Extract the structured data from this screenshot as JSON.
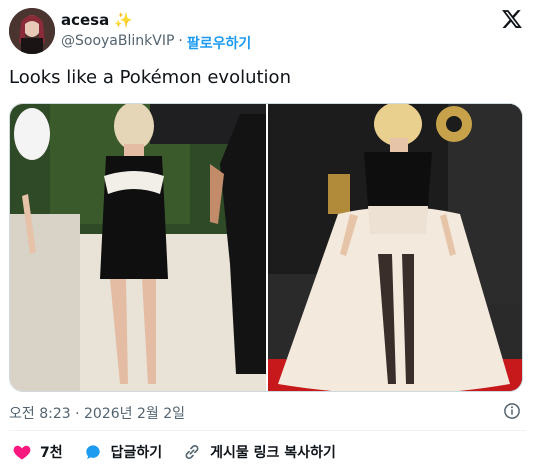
{
  "author": {
    "display_name": "acesa",
    "badge": "✨",
    "handle": "@SooyaBlinkVIP",
    "separator": "·",
    "follow_label": "팔로우하기"
  },
  "tweet": {
    "text": "Looks like a Pokémon evolution",
    "timestamp": "오전 8:23 · 2026년 2월 2일"
  },
  "actions": {
    "like_count": "7천",
    "reply_label": "답글하기",
    "copy_link_label": "게시물 링크 복사하기"
  },
  "colors": {
    "accent": "#1d9bf0",
    "like": "#f91880",
    "secondary_text": "#536471"
  }
}
